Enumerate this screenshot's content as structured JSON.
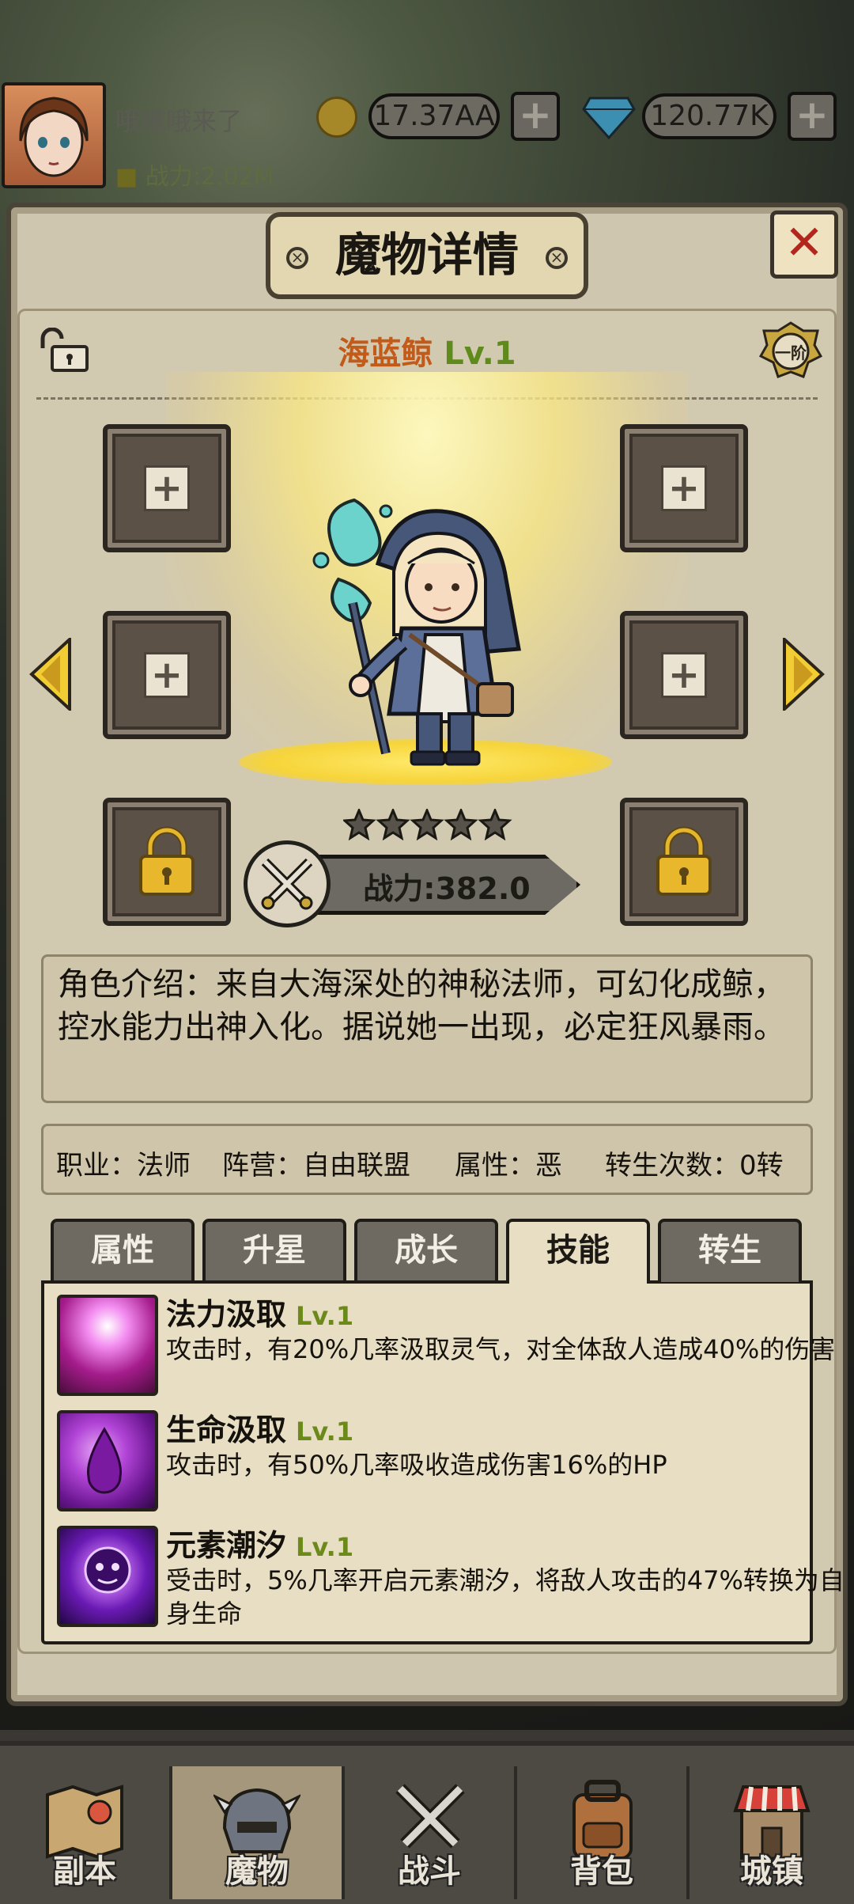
{
  "player": {
    "name": "哦哦哦来了",
    "power": "战力:2.02M",
    "gold": "17.37AA",
    "diamond": "120.77K"
  },
  "panel": {
    "title": "魔物详情",
    "close_icon": "close-x-icon"
  },
  "monster": {
    "name": "海蓝鲸",
    "level": "Lv.1",
    "rank": "一阶",
    "stars": 5,
    "power": "战力:382.0",
    "description": "角色介绍：来自大海深处的神秘法师，可幻化成鲸，控水能力出神入化。据说她一出现，必定狂风暴雨。"
  },
  "info": {
    "job": "职业：法师",
    "camp": "阵营：自由联盟",
    "attribute": "属性：恶",
    "rebirth": "转生次数：0转"
  },
  "tabs": [
    {
      "label": "属性",
      "active": false
    },
    {
      "label": "升星",
      "active": false
    },
    {
      "label": "成长",
      "active": false
    },
    {
      "label": "技能",
      "active": true
    },
    {
      "label": "转生",
      "active": false
    }
  ],
  "skills": [
    {
      "name": "法力汲取",
      "level": "Lv.1",
      "desc": "攻击时，有20%几率汲取灵气，对全体敌人造成40%的伤害",
      "icon": "mana-drain-icon"
    },
    {
      "name": "生命汲取",
      "level": "Lv.1",
      "desc": "攻击时，有50%几率吸收造成伤害16%的HP",
      "icon": "life-drain-icon"
    },
    {
      "name": "元素潮汐",
      "level": "Lv.1",
      "desc": "受击时，5%几率开启元素潮汐，将敌人攻击的47%转换为自身生命",
      "icon": "element-tide-icon"
    }
  ],
  "nav": [
    {
      "label": "副本",
      "icon": "map-icon",
      "active": false
    },
    {
      "label": "魔物",
      "icon": "monster-helmet-icon",
      "active": true
    },
    {
      "label": "战斗",
      "icon": "crossed-swords-icon",
      "active": false
    },
    {
      "label": "背包",
      "icon": "backpack-icon",
      "active": false
    },
    {
      "label": "城镇",
      "icon": "shop-icon",
      "active": false
    }
  ],
  "colors": {
    "accent_gold": "#f2cc33",
    "name_orange": "#c25a1a",
    "level_green": "#5f8a1c",
    "close_red": "#b3261e"
  }
}
